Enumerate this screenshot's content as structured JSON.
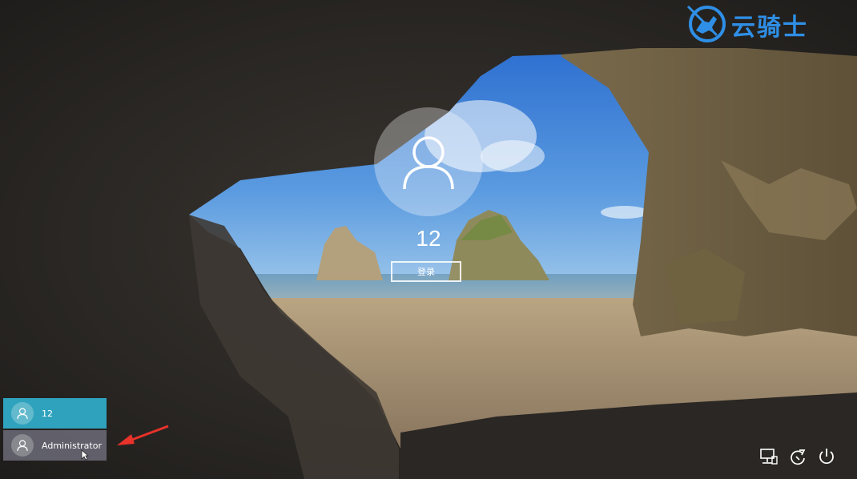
{
  "watermark": {
    "text": "云骑士",
    "logo_icon": "knight-logo-icon",
    "color": "#2f8fe6"
  },
  "lock_screen": {
    "username": "12",
    "signin_label": "登录"
  },
  "user_list": [
    {
      "name": "12",
      "selected": true
    },
    {
      "name": "Administrator",
      "selected": false
    }
  ],
  "system_icons": [
    "network-icon",
    "accessibility-icon",
    "power-icon"
  ],
  "colors": {
    "selected_user": "#2fa3bd",
    "annotation_arrow": "#e8322a"
  }
}
